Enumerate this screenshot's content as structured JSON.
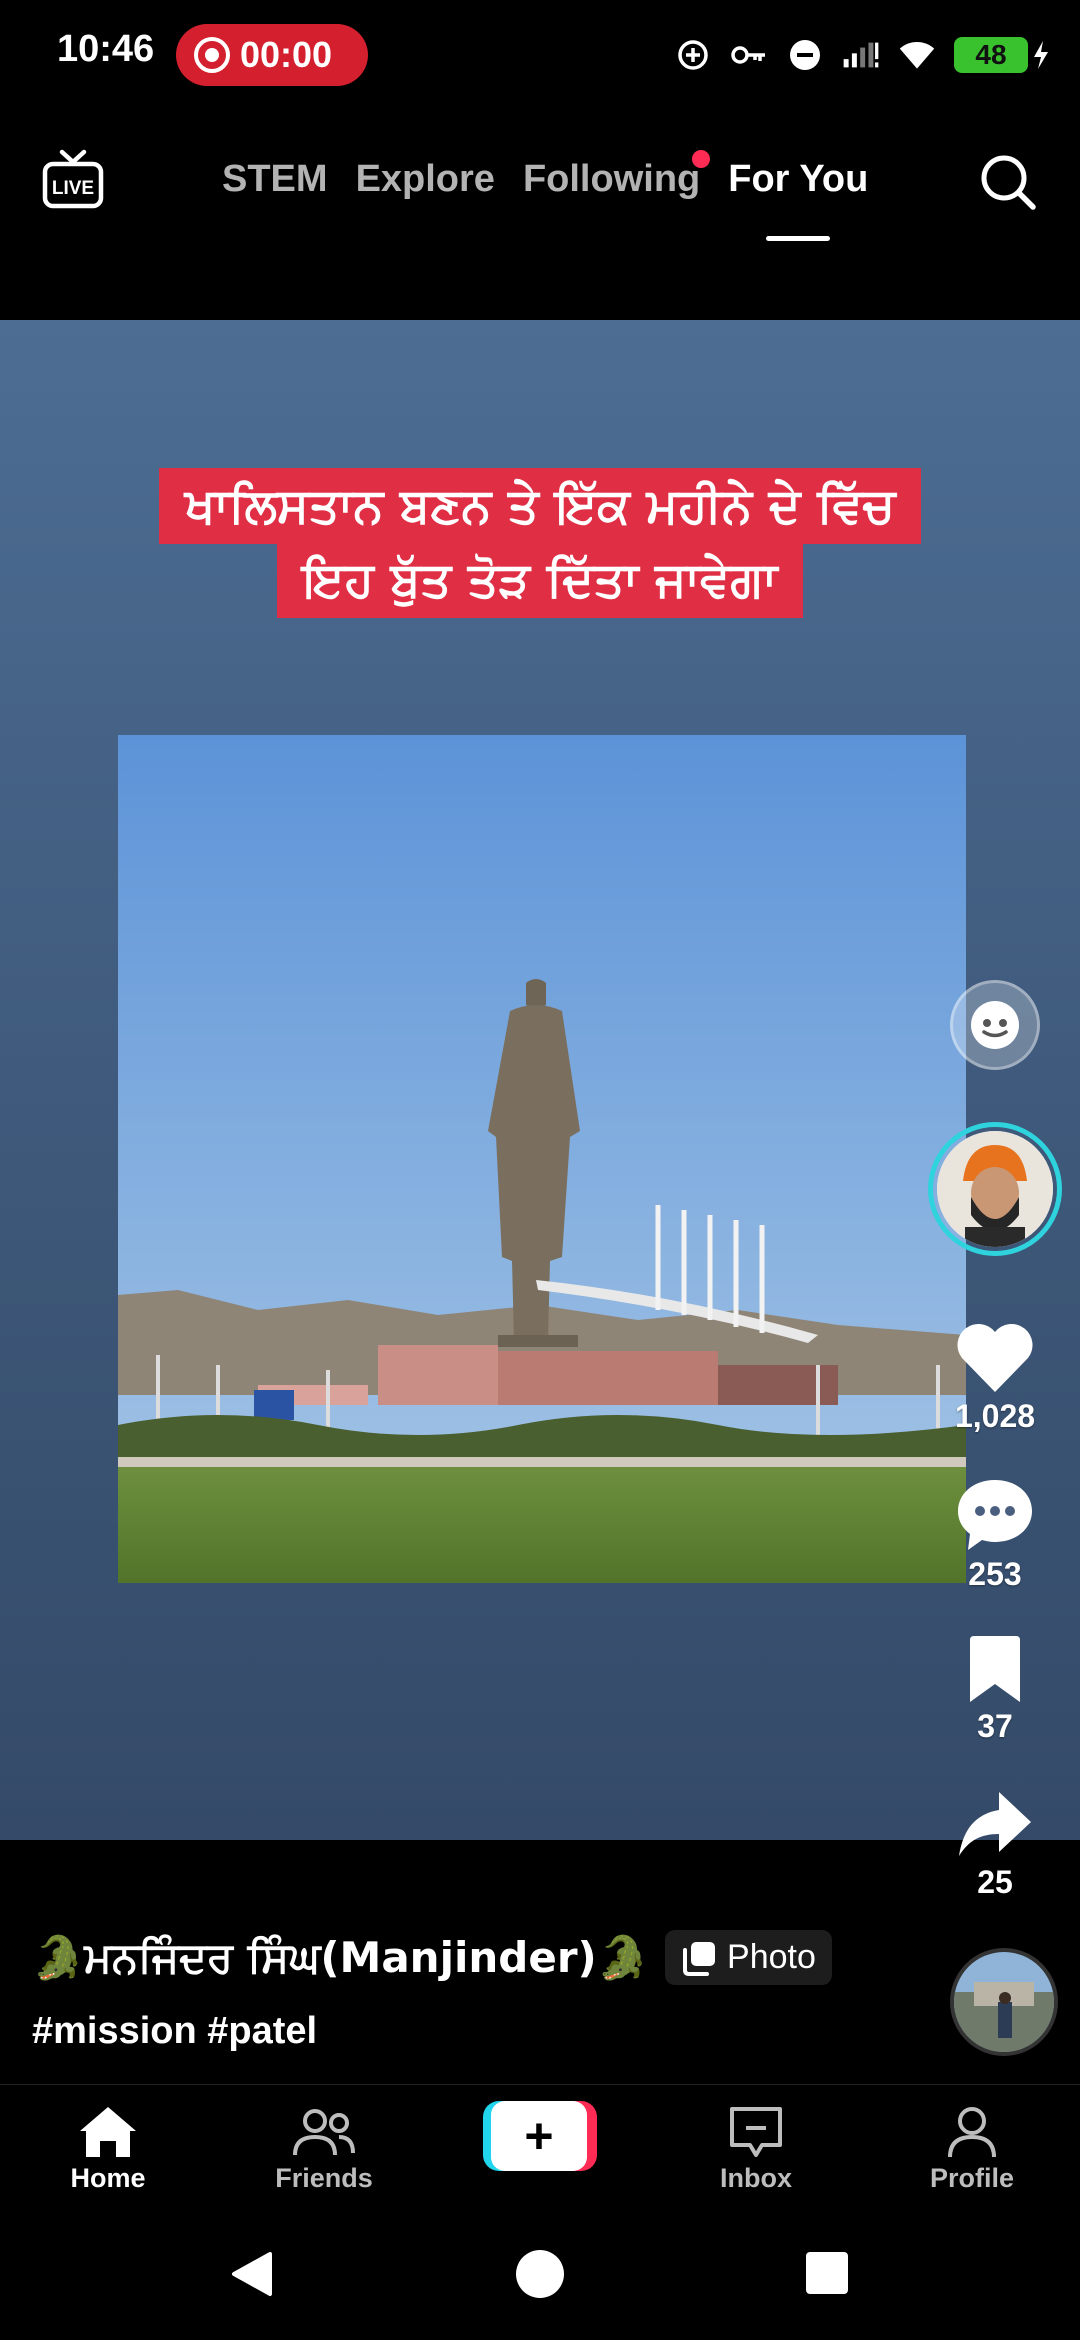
{
  "status_bar": {
    "time": "10:46",
    "recording_timer": "00:00",
    "battery": "48",
    "icons": [
      "data-saver-icon",
      "vpn-key-icon",
      "do-not-disturb-icon",
      "signal-icon",
      "wifi-icon",
      "battery-charging-icon"
    ]
  },
  "top_nav": {
    "tabs": [
      {
        "label": "STEM",
        "active": false
      },
      {
        "label": "Explore",
        "active": false
      },
      {
        "label": "Following",
        "active": false,
        "has_notification": true
      },
      {
        "label": "For You",
        "active": true
      }
    ]
  },
  "video": {
    "caption_lines": [
      "ਖਾਲਿਸਤਾਨ ਬਣਨ ਤੇ ਇੱਕ ਮਹੀਨੇ ਦੇ ਵਿੱਚ",
      "ਇਹ ਬੁੱਤ ਤੋੜ ਦਿੱਤਾ ਜਾਵੇਗਾ"
    ]
  },
  "actions": {
    "likes": "1,028",
    "comments": "253",
    "saves": "37",
    "shares": "25"
  },
  "post": {
    "author": "🐊ਮਨਜਿੰਦਰ ਸਿੰਘ(Manjinder)🐊",
    "badge": "Photo",
    "hashtags": "#mission #patel"
  },
  "bottom_nav": {
    "items": [
      {
        "label": "Home",
        "active": true
      },
      {
        "label": "Friends",
        "active": false
      },
      {
        "label": "Inbox",
        "active": false
      },
      {
        "label": "Profile",
        "active": false
      }
    ]
  },
  "colors": {
    "accent_red": "#fe2c55",
    "accent_cyan": "#20d5ec",
    "caption_bg": "#e02f45",
    "recording_pill": "#d41f2f",
    "battery_green": "#39c22e"
  }
}
